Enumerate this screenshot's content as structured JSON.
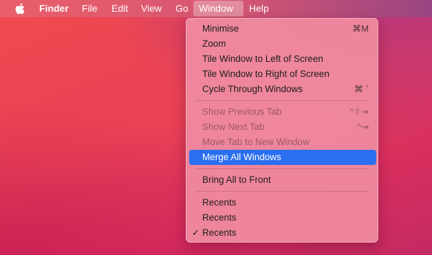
{
  "menubar": {
    "items": [
      {
        "label": "Finder"
      },
      {
        "label": "File"
      },
      {
        "label": "Edit"
      },
      {
        "label": "View"
      },
      {
        "label": "Go"
      },
      {
        "label": "Window"
      },
      {
        "label": "Help"
      }
    ],
    "active": "Window",
    "apple_icon": "apple-logo-icon"
  },
  "window_menu": {
    "items": [
      {
        "label": "Minimise",
        "shortcut": "⌘M",
        "enabled": true
      },
      {
        "label": "Zoom",
        "shortcut": "",
        "enabled": true
      },
      {
        "label": "Tile Window to Left of Screen",
        "shortcut": "",
        "enabled": true
      },
      {
        "label": "Tile Window to Right of Screen",
        "shortcut": "",
        "enabled": true
      },
      {
        "label": "Cycle Through Windows",
        "shortcut": "⌘ `",
        "enabled": true
      },
      {
        "label": "Show Previous Tab",
        "shortcut": "^⇧⇥",
        "enabled": false
      },
      {
        "label": "Show Next Tab",
        "shortcut": "^⇥",
        "enabled": false
      },
      {
        "label": "Move Tab to New Window",
        "shortcut": "",
        "enabled": false
      },
      {
        "label": "Merge All Windows",
        "shortcut": "",
        "enabled": true,
        "highlighted": true
      },
      {
        "label": "Bring All to Front",
        "shortcut": "",
        "enabled": true
      },
      {
        "label": "Recents",
        "shortcut": "",
        "enabled": true
      },
      {
        "label": "Recents",
        "shortcut": "",
        "enabled": true
      },
      {
        "label": "Recents",
        "shortcut": "",
        "enabled": true,
        "checked": true,
        "check_mark": "✓"
      }
    ]
  },
  "colors": {
    "highlight": "#2a6ff0",
    "menu_background": "#f08ca0",
    "desktop_top": "#f04a4f",
    "desktop_bottom": "#c22a62"
  }
}
